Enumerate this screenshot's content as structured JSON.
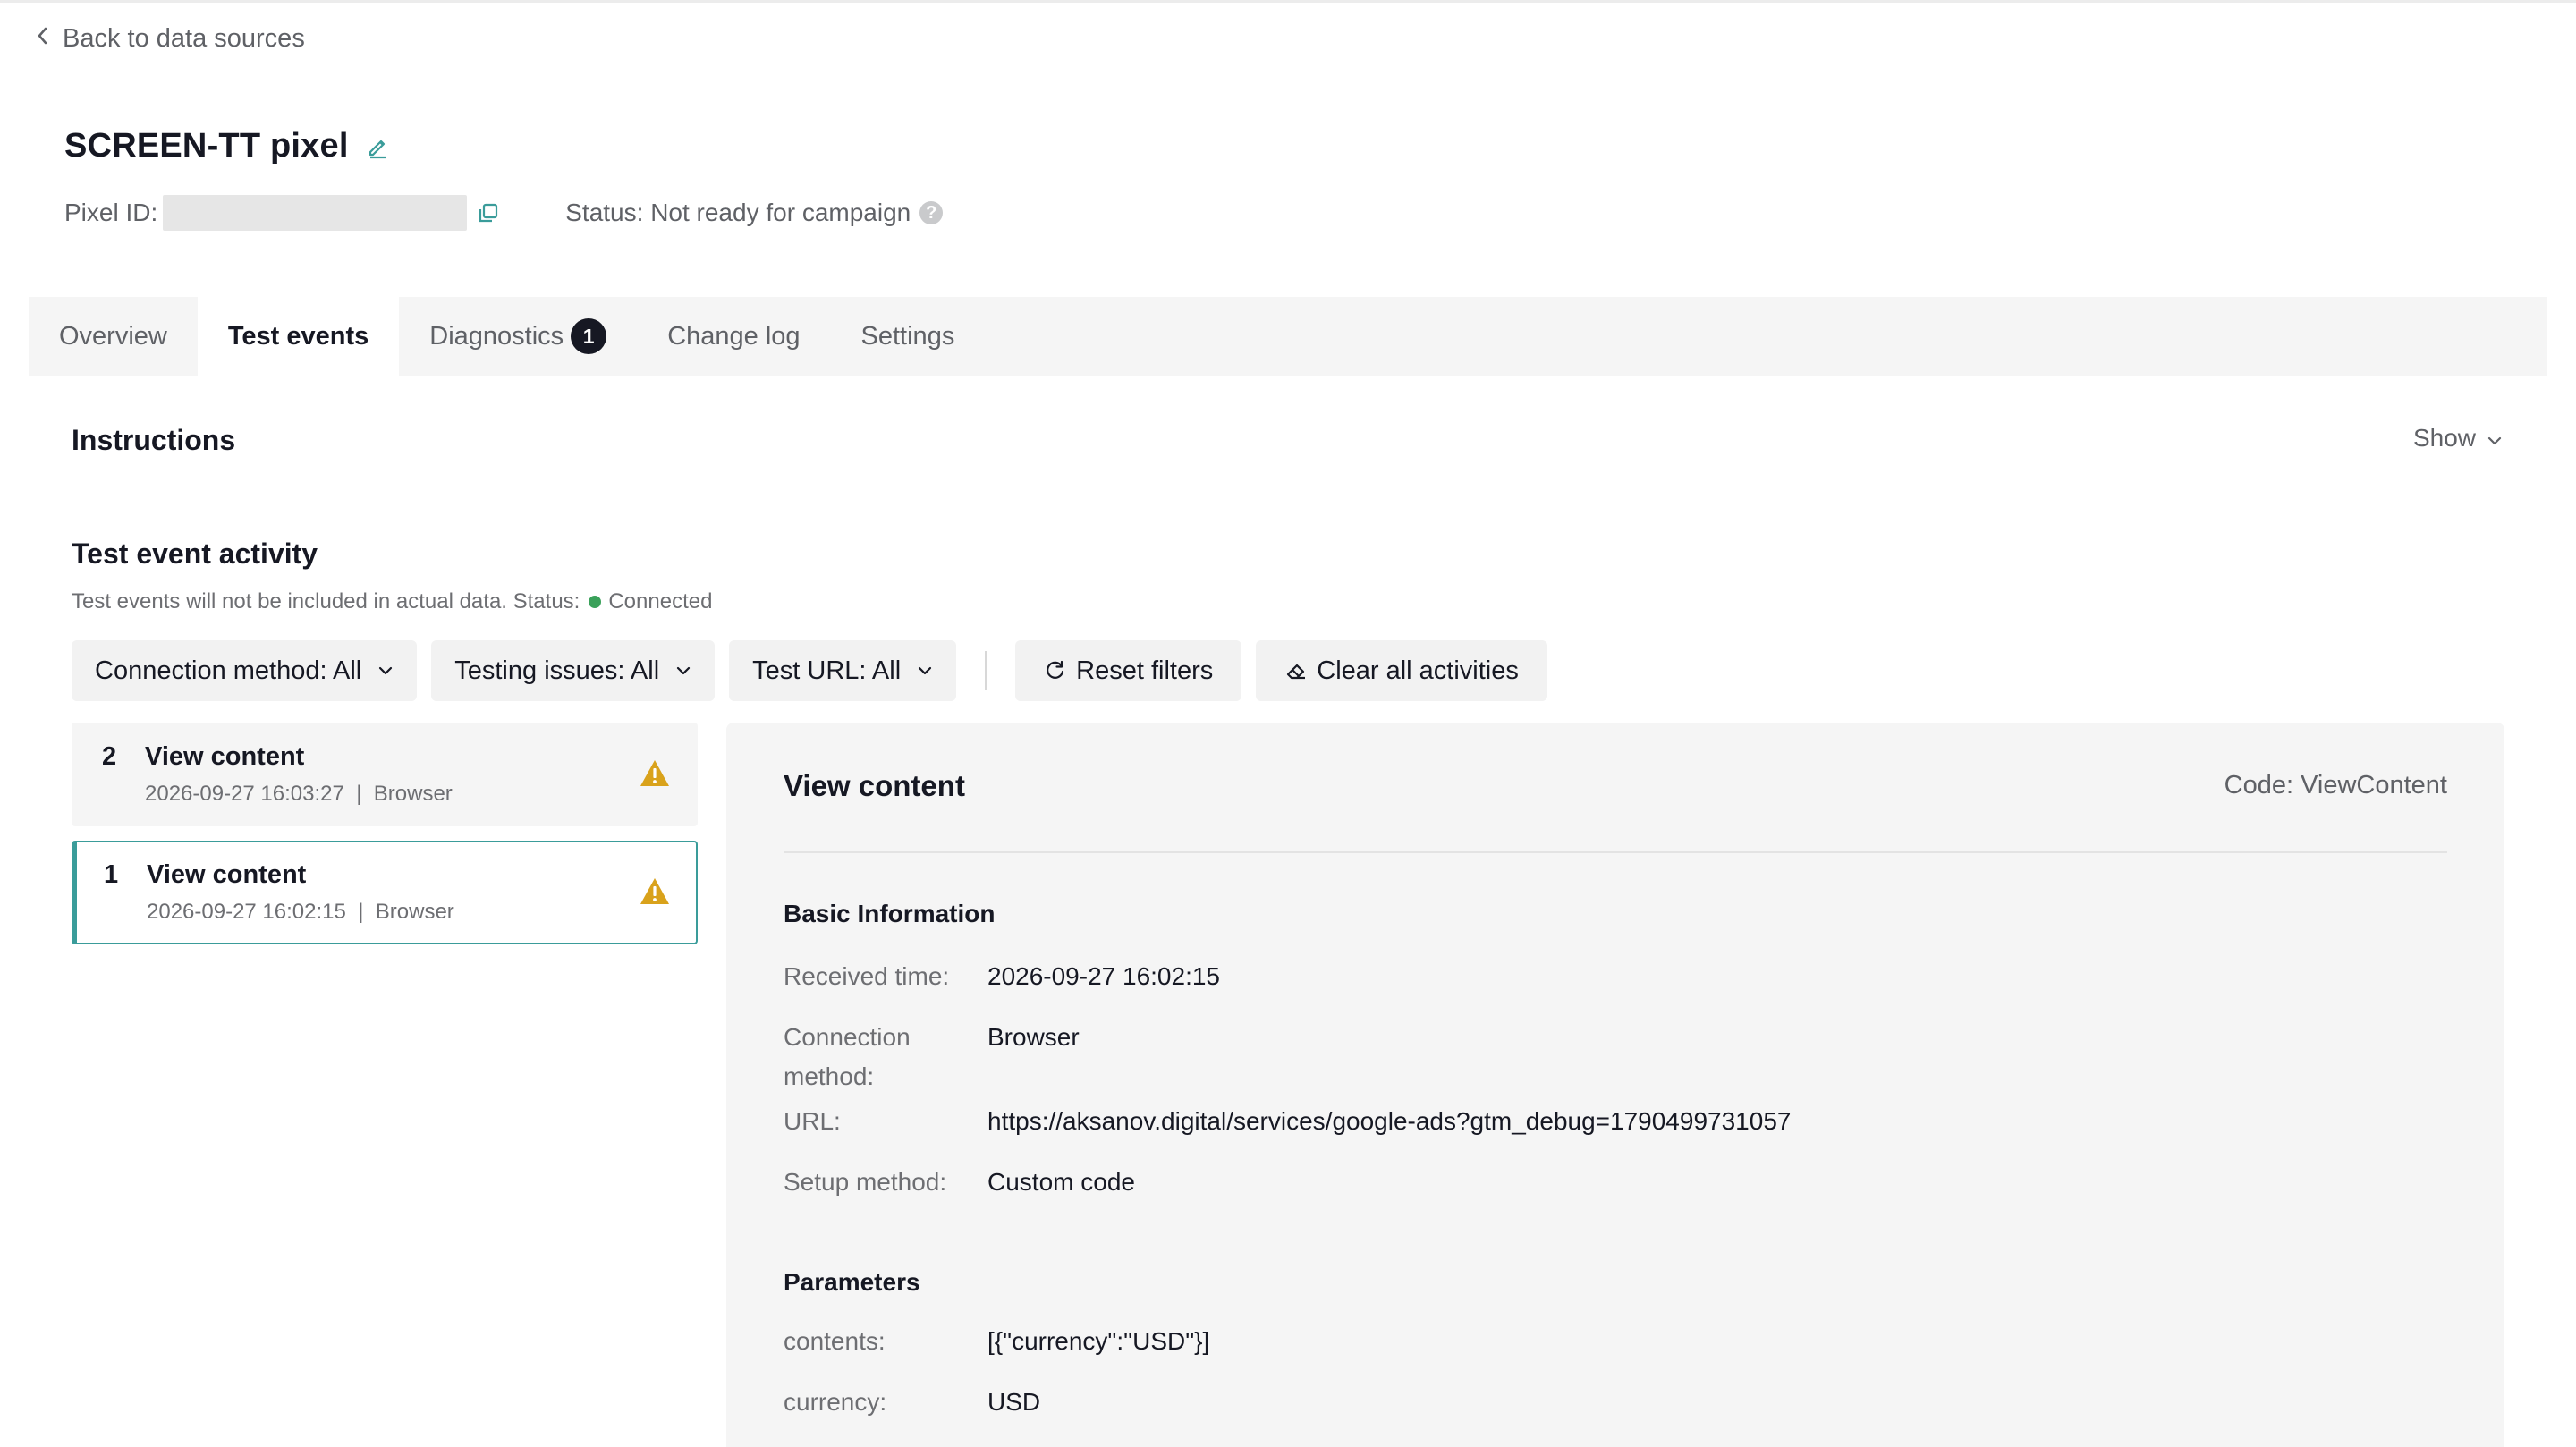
{
  "nav": {
    "back_label": "Back to data sources"
  },
  "pixel": {
    "title": "SCREEN-TT pixel",
    "id_label": "Pixel ID:",
    "status_text": "Status: Not ready for campaign"
  },
  "tabs": [
    {
      "label": "Overview"
    },
    {
      "label": "Test events"
    },
    {
      "label": "Diagnostics",
      "badge": "1"
    },
    {
      "label": "Change log"
    },
    {
      "label": "Settings"
    }
  ],
  "instructions": {
    "title": "Instructions",
    "toggle_label": "Show"
  },
  "activity": {
    "title": "Test event activity",
    "subtitle": "Test events will not be included in actual data. Status:",
    "connection_status": "Connected",
    "status_color": "#3aa15a"
  },
  "filters": [
    {
      "label": "Connection method: All"
    },
    {
      "label": "Testing issues: All"
    },
    {
      "label": "Test URL: All"
    }
  ],
  "actions": {
    "reset_label": "Reset filters",
    "clear_label": "Clear all activities"
  },
  "events": [
    {
      "number": "2",
      "name": "View content",
      "meta": "2026-09-27 16:03:27  |  Browser"
    },
    {
      "number": "1",
      "name": "View content",
      "meta": "2026-09-27 16:02:15  |  Browser"
    }
  ],
  "detail": {
    "title": "View content",
    "code": "Code: ViewContent",
    "basic_heading": "Basic Information",
    "received_label": "Received time:",
    "received_value": "2026-09-27 16:02:15",
    "connection_label": "Connection method:",
    "connection_value": "Browser",
    "url_label": "URL:",
    "url_value": "https://aksanov.digital/services/google-ads?gtm_debug=1790499731057",
    "setup_label": "Setup method:",
    "setup_value": "Custom code",
    "params_heading": "Parameters",
    "contents_label": "contents:",
    "contents_value": "[{\"currency\":\"USD\"}]",
    "currency_label": "currency:",
    "currency_value": "USD"
  },
  "colors": {
    "accent": "#3a9c9a",
    "warning": "#d9a21b"
  }
}
